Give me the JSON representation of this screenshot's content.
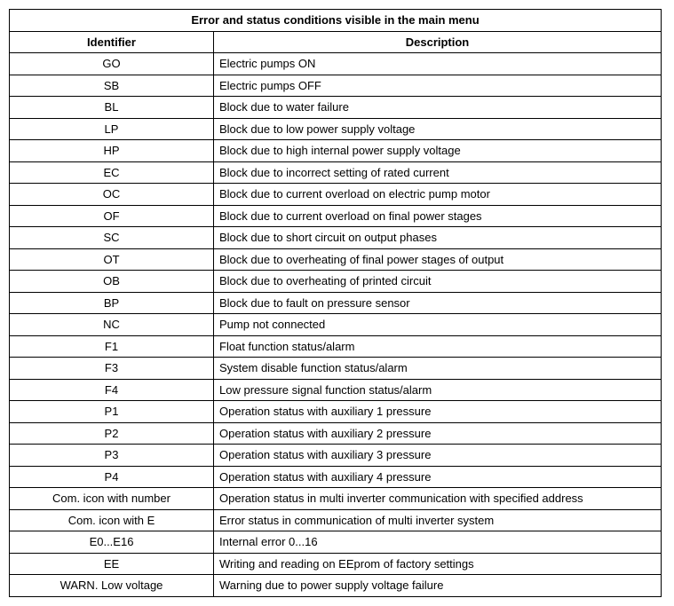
{
  "table": {
    "title": "Error and status conditions visible in the main menu",
    "headers": {
      "identifier": "Identifier",
      "description": "Description"
    },
    "rows": [
      {
        "identifier": "GO",
        "description": "Electric pumps ON"
      },
      {
        "identifier": "SB",
        "description": "Electric pumps OFF"
      },
      {
        "identifier": "BL",
        "description": "Block due to water failure"
      },
      {
        "identifier": "LP",
        "description": "Block due to low power supply voltage"
      },
      {
        "identifier": "HP",
        "description": "Block due to high internal power supply voltage"
      },
      {
        "identifier": "EC",
        "description": "Block due to incorrect setting of rated current"
      },
      {
        "identifier": "OC",
        "description": "Block due to current overload on electric pump motor"
      },
      {
        "identifier": "OF",
        "description": "Block due to current overload on final power stages"
      },
      {
        "identifier": "SC",
        "description": "Block due to short circuit on output phases"
      },
      {
        "identifier": "OT",
        "description": "Block due to overheating of final power stages of output"
      },
      {
        "identifier": "OB",
        "description": "Block due to overheating of printed circuit"
      },
      {
        "identifier": "BP",
        "description": "Block due to fault on pressure sensor"
      },
      {
        "identifier": "NC",
        "description": "Pump not connected"
      },
      {
        "identifier": "F1",
        "description": "Float function status/alarm"
      },
      {
        "identifier": "F3",
        "description": "System disable function status/alarm"
      },
      {
        "identifier": "F4",
        "description": "Low pressure signal function status/alarm"
      },
      {
        "identifier": "P1",
        "description": "Operation status with auxiliary 1 pressure"
      },
      {
        "identifier": "P2",
        "description": "Operation status with auxiliary 2 pressure"
      },
      {
        "identifier": "P3",
        "description": "Operation status with auxiliary 3 pressure"
      },
      {
        "identifier": "P4",
        "description": "Operation status with auxiliary 4 pressure"
      },
      {
        "identifier": "Com. icon with number",
        "description": "Operation status in multi inverter communication with specified address"
      },
      {
        "identifier": "Com. icon with E",
        "description": "Error status in communication of multi inverter system"
      },
      {
        "identifier": "E0...E16",
        "description": "Internal error 0...16"
      },
      {
        "identifier": "EE",
        "description": "Writing and reading on EEprom of factory settings"
      },
      {
        "identifier": "WARN. Low voltage",
        "description": "Warning due to power supply voltage failure"
      }
    ]
  }
}
